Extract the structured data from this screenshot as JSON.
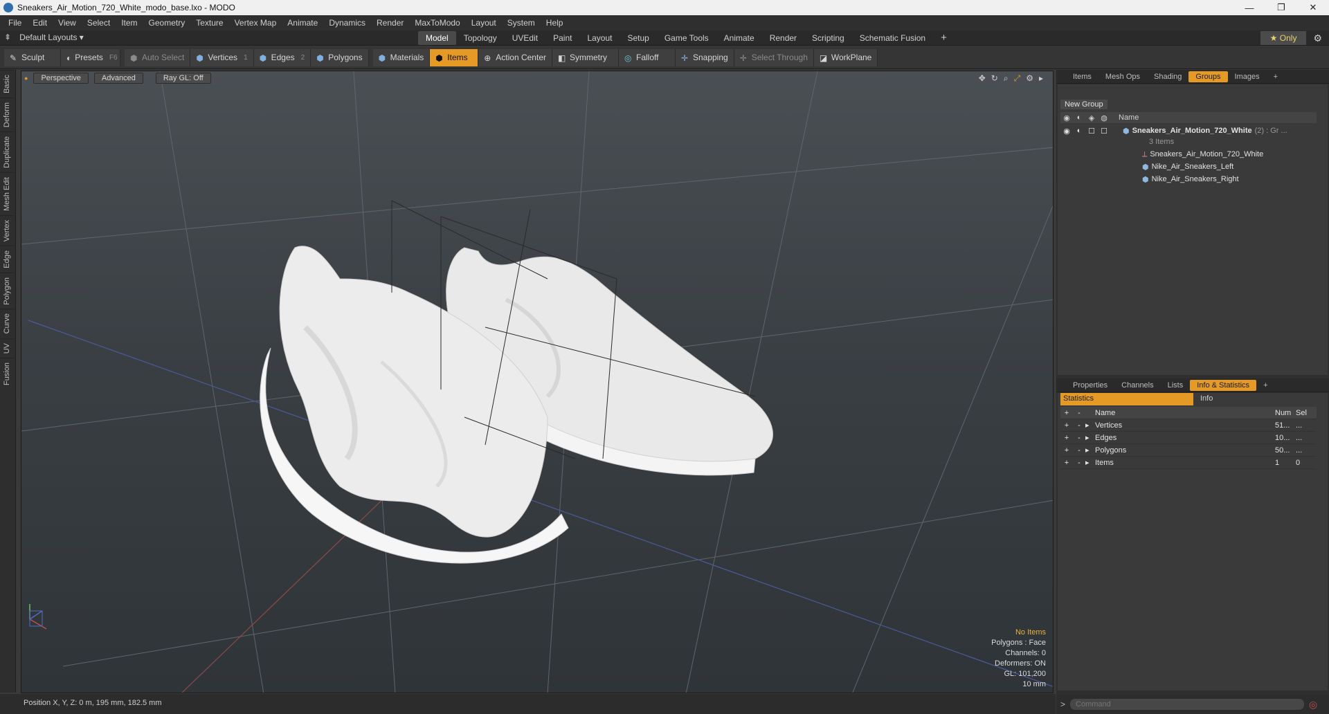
{
  "window": {
    "title": "Sneakers_Air_Motion_720_White_modo_base.lxo - MODO",
    "minimize": "—",
    "maximize": "❐",
    "close": "✕"
  },
  "menu": [
    "File",
    "Edit",
    "View",
    "Select",
    "Item",
    "Geometry",
    "Texture",
    "Vertex Map",
    "Animate",
    "Dynamics",
    "Render",
    "MaxToModo",
    "Layout",
    "System",
    "Help"
  ],
  "layouts": {
    "label": "Default Layouts ▾",
    "tabs": [
      "Model",
      "Topology",
      "UVEdit",
      "Paint",
      "Layout",
      "Setup",
      "Game Tools",
      "Animate",
      "Render",
      "Scripting",
      "Schematic Fusion"
    ],
    "active": "Model",
    "only": "★  Only"
  },
  "toolbar": {
    "sculpt": "Sculpt",
    "presets": "Presets",
    "presets_key": "F6",
    "auto_select": "Auto Select",
    "vertices": "Vertices",
    "vertices_key": "1",
    "edges": "Edges",
    "edges_key": "2",
    "polygons": "Polygons",
    "materials": "Materials",
    "items": "Items",
    "action_center": "Action Center",
    "symmetry": "Symmetry",
    "falloff": "Falloff",
    "snapping": "Snapping",
    "select_through": "Select Through",
    "workplane": "WorkPlane"
  },
  "left_tabs": [
    "Basic",
    "Deform",
    "Duplicate",
    "Mesh Edit",
    "Vertex",
    "Edge",
    "Polygon",
    "Curve",
    "UV",
    "Fusion"
  ],
  "viewport": {
    "view": "Perspective",
    "shading": "Advanced",
    "raygl": "Ray GL: Off",
    "info": [
      "No Items",
      "Polygons : Face",
      "Channels: 0",
      "Deformers: ON",
      "GL: 101,200",
      "10 mm"
    ]
  },
  "status": {
    "position": "Position X, Y, Z:  0 m, 195 mm, 182.5 mm"
  },
  "top_panel": {
    "tabs": [
      "Items",
      "Mesh Ops",
      "Shading",
      "Groups",
      "Images"
    ],
    "active": "Groups",
    "new_group": "New Group",
    "name_col": "Name",
    "group": {
      "name": "Sneakers_Air_Motion_720_White",
      "suffix": "(2) : Gr ...",
      "count": "3 Items"
    },
    "children": [
      "Sneakers_Air_Motion_720_White",
      "Nike_Air_Sneakers_Left",
      "Nike_Air_Sneakers_Right"
    ]
  },
  "bottom_panel": {
    "tabs": [
      "Properties",
      "Channels",
      "Lists",
      "Info & Statistics"
    ],
    "active": "Info & Statistics",
    "subtabs": [
      "Statistics",
      "Info"
    ],
    "columns": [
      "Name",
      "Num",
      "Sel"
    ],
    "rows": [
      {
        "name": "Vertices",
        "num": "51...",
        "sel": "..."
      },
      {
        "name": "Edges",
        "num": "10...",
        "sel": "..."
      },
      {
        "name": "Polygons",
        "num": "50...",
        "sel": "..."
      },
      {
        "name": "Items",
        "num": "1",
        "sel": "0"
      }
    ]
  },
  "command": {
    "placeholder": "Command"
  },
  "colors": {
    "accent": "#e49a24",
    "warn": "#e9b43b"
  }
}
